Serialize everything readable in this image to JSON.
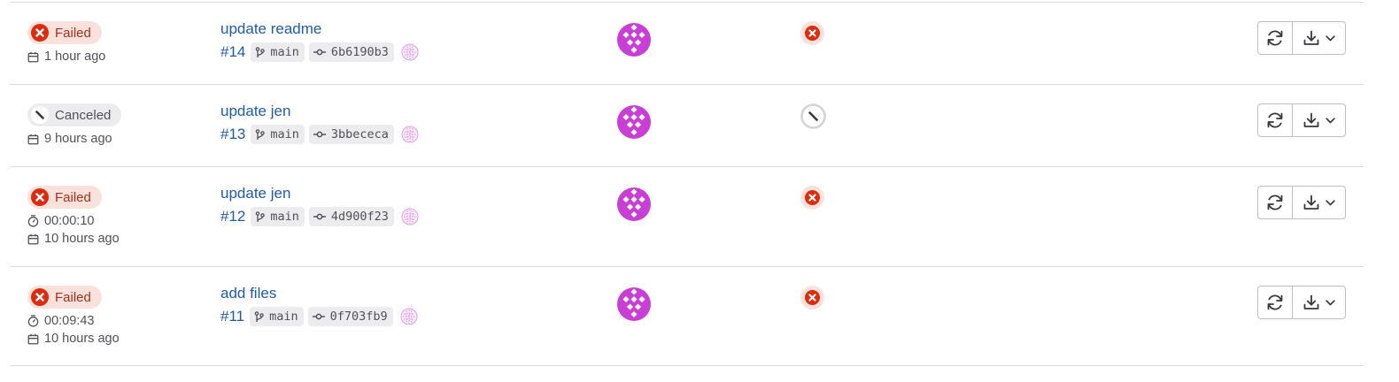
{
  "pipelines": [
    {
      "status": "Failed",
      "duration": "",
      "finished": "1 hour ago",
      "title": "update readme",
      "id": "#14",
      "branch": "main",
      "commit": "6b6190b3",
      "stage_status": "failed"
    },
    {
      "status": "Canceled",
      "duration": "",
      "finished": "9 hours ago",
      "title": "update jen",
      "id": "#13",
      "branch": "main",
      "commit": "3bbececa",
      "stage_status": "canceled"
    },
    {
      "status": "Failed",
      "duration": "00:00:10",
      "finished": "10 hours ago",
      "title": "update jen",
      "id": "#12",
      "branch": "main",
      "commit": "4d900f23",
      "stage_status": "failed"
    },
    {
      "status": "Failed",
      "duration": "00:09:43",
      "finished": "10 hours ago",
      "title": "add files",
      "id": "#11",
      "branch": "main",
      "commit": "0f703fb9",
      "stage_status": "failed"
    }
  ],
  "icons": {
    "failed": "status-failed-icon",
    "canceled": "status-canceled-icon",
    "calendar": "calendar-icon",
    "timer": "timer-icon",
    "branch": "branch-icon",
    "commit": "commit-icon",
    "retry": "retry-icon",
    "download": "download-icon",
    "chevron": "chevron-down-icon"
  },
  "colors": {
    "failed_bg": "#fbe1dc",
    "failed_fg": "#dd2b0e",
    "canceled_bg": "#ececef",
    "link": "#1f5ca8",
    "avatar": "#c93fd6"
  }
}
